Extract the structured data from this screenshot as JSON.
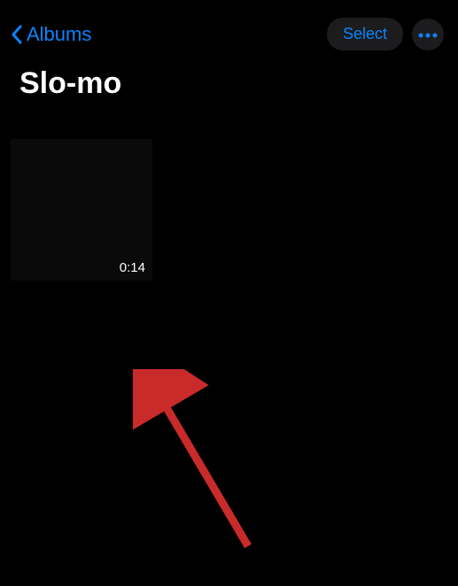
{
  "header": {
    "back_label": "Albums",
    "select_label": "Select"
  },
  "page": {
    "title": "Slo-mo"
  },
  "video": {
    "duration": "0:14"
  }
}
